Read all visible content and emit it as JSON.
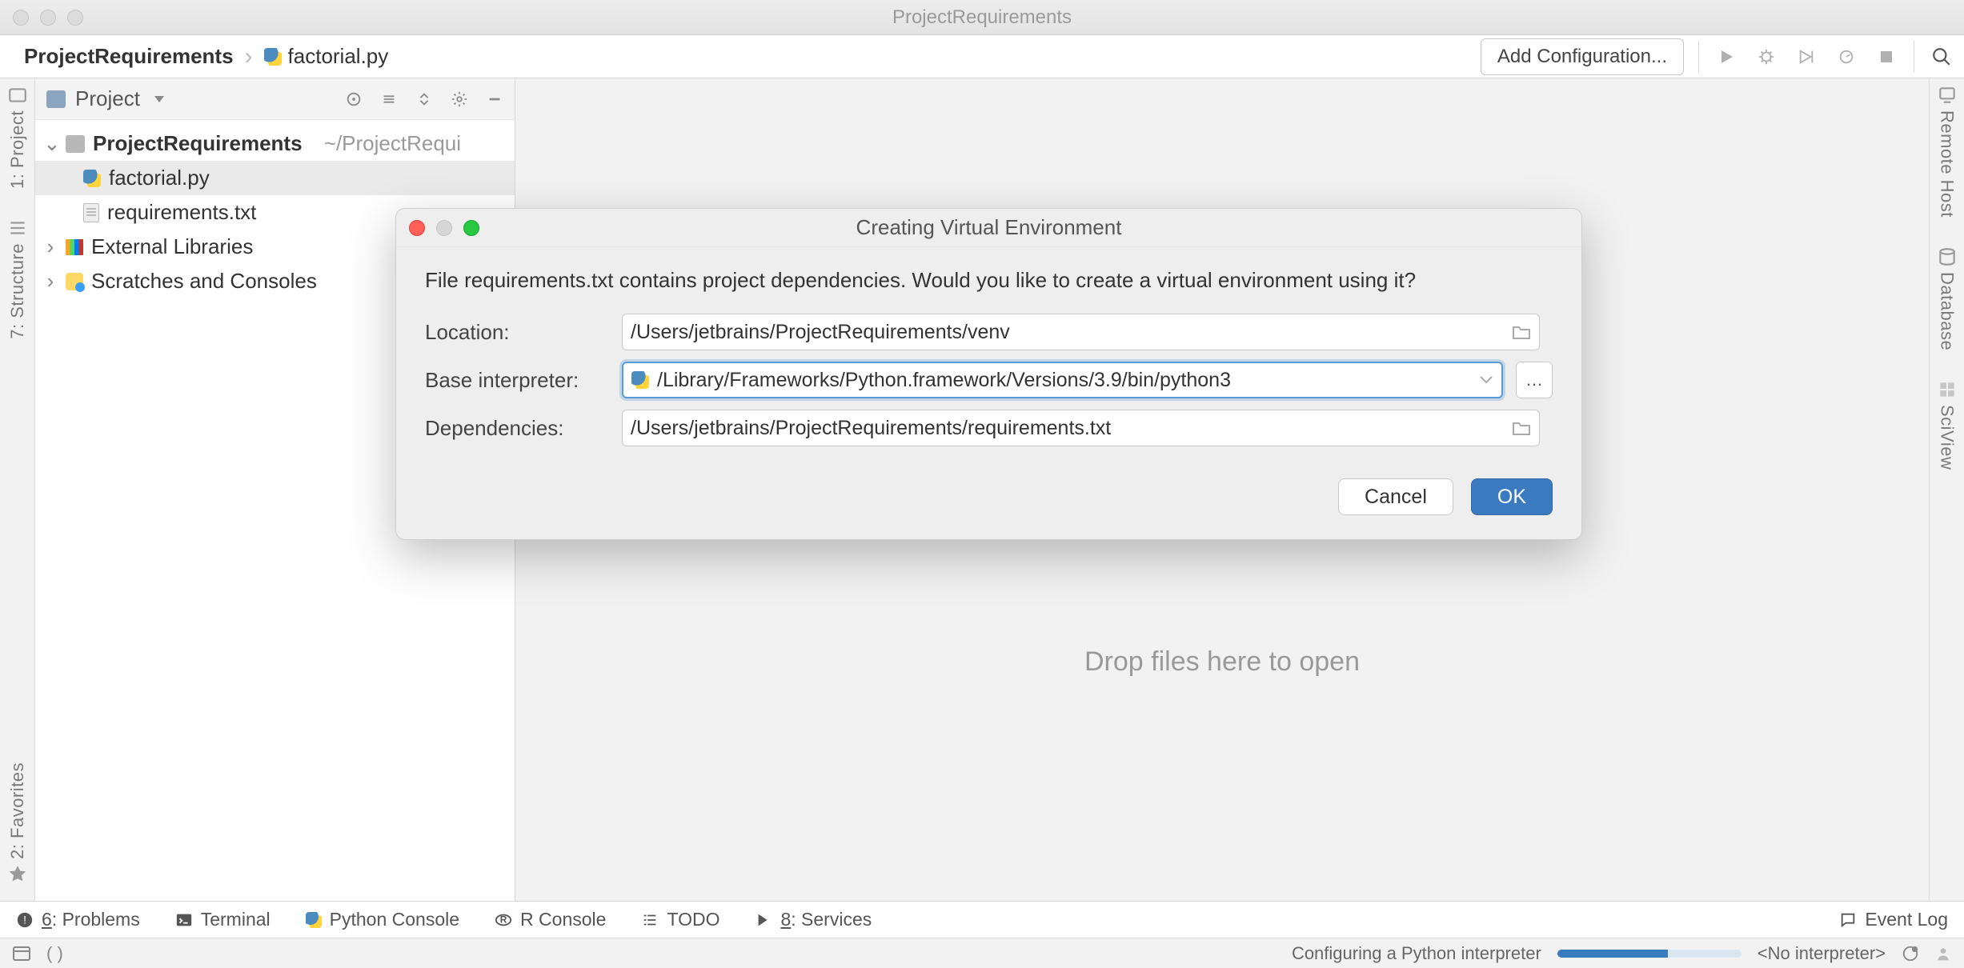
{
  "window": {
    "title": "ProjectRequirements"
  },
  "navbar": {
    "breadcrumb": {
      "project": "ProjectRequirements",
      "file": "factorial.py"
    },
    "add_config": "Add Configuration..."
  },
  "leftrail": {
    "project": "1: Project",
    "structure": "7: Structure",
    "favorites": "2: Favorites"
  },
  "rightrail": {
    "remote": "Remote Host",
    "database": "Database",
    "sciview": "SciView"
  },
  "sidebar": {
    "view_label": "Project",
    "root": {
      "name": "ProjectRequirements",
      "path": "~/ProjectRequi"
    },
    "files": [
      {
        "name": "factorial.py",
        "kind": "py",
        "selected": true
      },
      {
        "name": "requirements.txt",
        "kind": "txt",
        "selected": false
      }
    ],
    "external": "External Libraries",
    "scratches": "Scratches and Consoles"
  },
  "editor": {
    "placeholder": "Drop files here to open"
  },
  "dialog": {
    "title": "Creating Virtual Environment",
    "message": "File requirements.txt contains project dependencies. Would you like to create a virtual environment using it?",
    "fields": {
      "location": {
        "label": "Location:",
        "value": "/Users/jetbrains/ProjectRequirements/venv"
      },
      "interpreter": {
        "label": "Base interpreter:",
        "value": "/Library/Frameworks/Python.framework/Versions/3.9/bin/python3"
      },
      "dependencies": {
        "label": "Dependencies:",
        "value": "/Users/jetbrains/ProjectRequirements/requirements.txt"
      }
    },
    "buttons": {
      "cancel": "Cancel",
      "ok": "OK"
    }
  },
  "bottombar": {
    "problems": "6: Problems",
    "terminal": "Terminal",
    "python_console": "Python Console",
    "r_console": "R Console",
    "todo": "TODO",
    "services": "8: Services",
    "event_log": "Event Log"
  },
  "statusbar": {
    "progress_label": "Configuring a Python interpreter",
    "interpreter": "<No interpreter>"
  }
}
